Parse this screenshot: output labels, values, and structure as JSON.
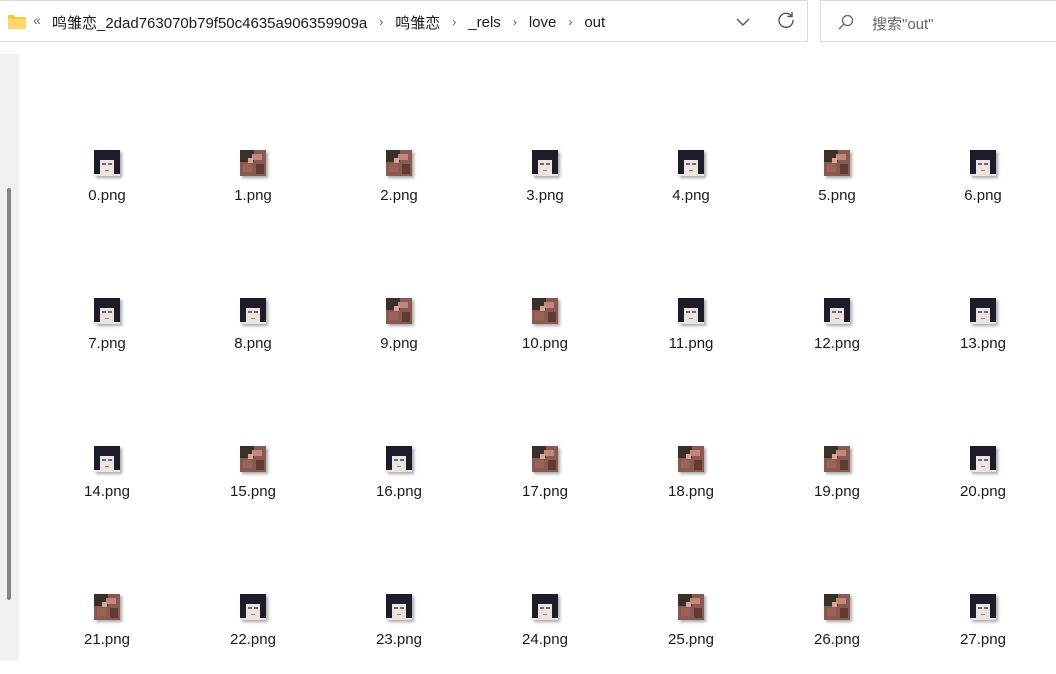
{
  "breadcrumb": {
    "items": [
      "鸣雏恋_2dad763070b79f50c4635a906359909a",
      "鸣雏恋",
      "_rels",
      "love",
      "out"
    ]
  },
  "search": {
    "placeholder": "搜索\"out\""
  },
  "files": [
    {
      "name": "0.png",
      "thumb": "girl"
    },
    {
      "name": "1.png",
      "thumb": "boy"
    },
    {
      "name": "2.png",
      "thumb": "boy"
    },
    {
      "name": "3.png",
      "thumb": "girl"
    },
    {
      "name": "4.png",
      "thumb": "girl"
    },
    {
      "name": "5.png",
      "thumb": "boy"
    },
    {
      "name": "6.png",
      "thumb": "girl"
    },
    {
      "name": "7.png",
      "thumb": "girl"
    },
    {
      "name": "8.png",
      "thumb": "girl"
    },
    {
      "name": "9.png",
      "thumb": "boy"
    },
    {
      "name": "10.png",
      "thumb": "boy"
    },
    {
      "name": "11.png",
      "thumb": "girl"
    },
    {
      "name": "12.png",
      "thumb": "girl"
    },
    {
      "name": "13.png",
      "thumb": "girl"
    },
    {
      "name": "14.png",
      "thumb": "girl"
    },
    {
      "name": "15.png",
      "thumb": "boy"
    },
    {
      "name": "16.png",
      "thumb": "girl"
    },
    {
      "name": "17.png",
      "thumb": "boy"
    },
    {
      "name": "18.png",
      "thumb": "boy"
    },
    {
      "name": "19.png",
      "thumb": "boy"
    },
    {
      "name": "20.png",
      "thumb": "girl"
    },
    {
      "name": "21.png",
      "thumb": "boy"
    },
    {
      "name": "22.png",
      "thumb": "girl"
    },
    {
      "name": "23.png",
      "thumb": "girl"
    },
    {
      "name": "24.png",
      "thumb": "girl"
    },
    {
      "name": "25.png",
      "thumb": "boy"
    },
    {
      "name": "26.png",
      "thumb": "boy"
    },
    {
      "name": "27.png",
      "thumb": "girl"
    }
  ],
  "colors": {
    "folder": "#f7c94b",
    "text": "#1a1a1a",
    "scrollbar": "#858585"
  },
  "icons": {
    "folder": "folder-icon",
    "overflow": "double-chevron-left-icon",
    "separator": "chevron-right-icon",
    "dropdown": "chevron-down-icon",
    "refresh": "refresh-icon",
    "search": "search-icon"
  }
}
